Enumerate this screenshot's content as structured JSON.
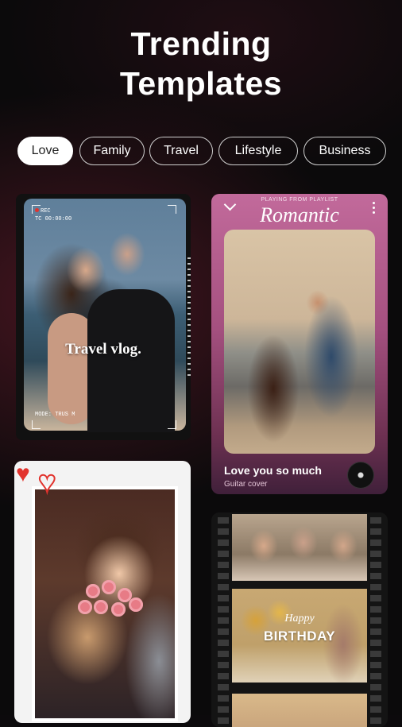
{
  "header": {
    "title_line1": "Trending",
    "title_line2": "Templates"
  },
  "categories": [
    {
      "label": "Love",
      "active": true
    },
    {
      "label": "Family",
      "active": false
    },
    {
      "label": "Travel",
      "active": false
    },
    {
      "label": "Lifestyle",
      "active": false
    },
    {
      "label": "Business",
      "active": false
    }
  ],
  "templates": {
    "travel_vlog": {
      "caption": "Travel vlog.",
      "rec_label": "REC",
      "timecode": "TC 00:00:00",
      "mode_label": "MODE: TRUS M"
    },
    "romantic": {
      "top_label": "PLAYING FROM PLAYLIST",
      "playlist_name": "Romantic",
      "song_title": "Love you so much",
      "song_subtitle": "Guitar cover"
    },
    "birthday": {
      "happy": "Happy",
      "birthday": "BIRTHDAY"
    }
  },
  "colors": {
    "accent": "#e2332d",
    "chip_border": "#cfcfcf",
    "romantic_pink": "#c26a9b"
  },
  "icons": [
    "chevron-down-icon",
    "more-vertical-icon",
    "vinyl-disc-icon",
    "heart-icon",
    "camera-rec-icon"
  ]
}
